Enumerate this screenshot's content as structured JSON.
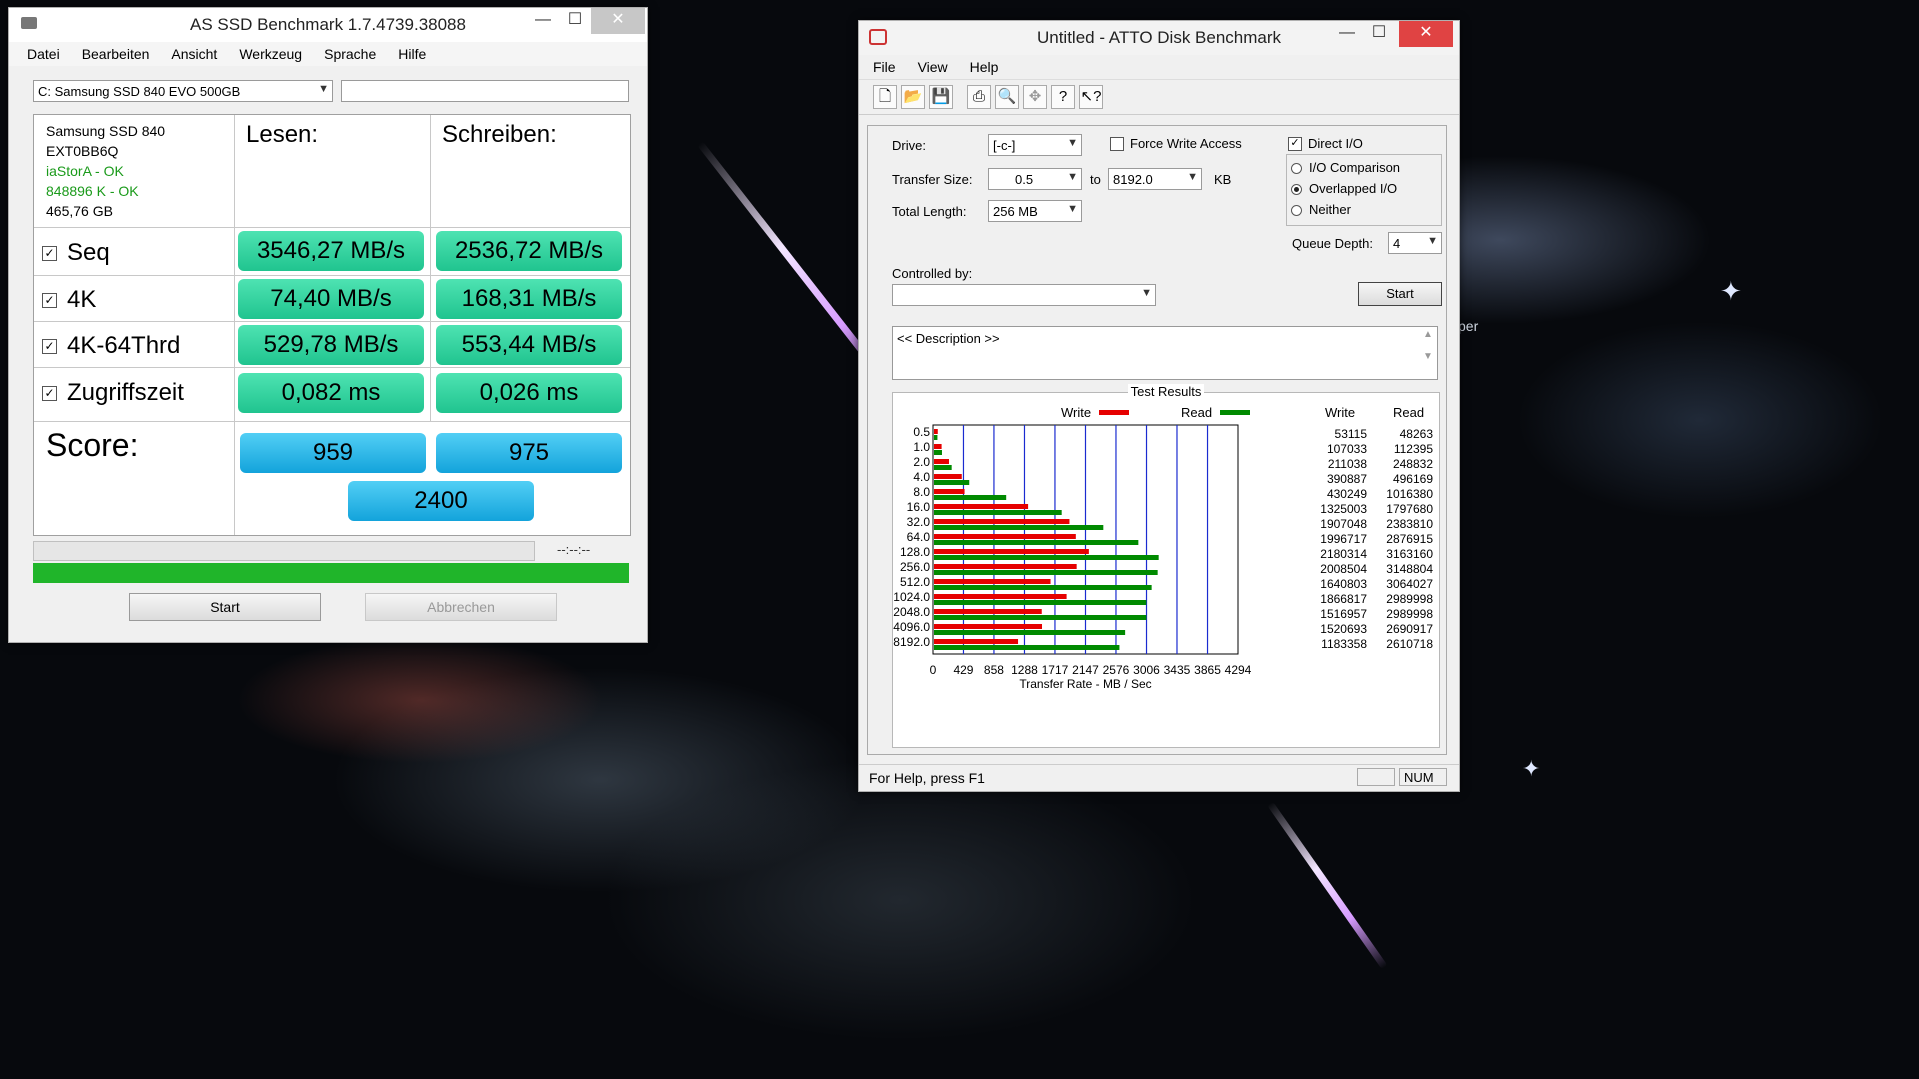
{
  "desktop": {
    "partial_text": "per"
  },
  "asssd": {
    "title": "AS SSD Benchmark 1.7.4739.38088",
    "menu": [
      "Datei",
      "Bearbeiten",
      "Ansicht",
      "Werkzeug",
      "Sprache",
      "Hilfe"
    ],
    "drive_select": "C: Samsung SSD 840 EVO 500GB",
    "device": {
      "name": "Samsung SSD 840",
      "firmware": "EXT0BB6Q",
      "driver_status": "iaStorA - OK",
      "alignment_status": "848896 K - OK",
      "capacity": "465,76 GB"
    },
    "headers": {
      "read": "Lesen:",
      "write": "Schreiben:"
    },
    "rows": [
      {
        "label": "Seq",
        "read": "3546,27 MB/s",
        "write": "2536,72 MB/s"
      },
      {
        "label": "4K",
        "read": "74,40 MB/s",
        "write": "168,31 MB/s"
      },
      {
        "label": "4K-64Thrd",
        "read": "529,78 MB/s",
        "write": "553,44 MB/s"
      },
      {
        "label": "Zugriffszeit",
        "read": "0,082 ms",
        "write": "0,026 ms"
      }
    ],
    "score": {
      "label": "Score:",
      "read": "959",
      "write": "975",
      "total": "2400"
    },
    "timer": "--:--:--",
    "progress": 1.0,
    "buttons": {
      "start": "Start",
      "abort": "Abbrechen"
    },
    "colors": {
      "result_green": "#20c48f",
      "score_blue": "#13a3db",
      "progress_green": "#20b52a"
    }
  },
  "atto": {
    "title": "Untitled - ATTO Disk Benchmark",
    "menu": [
      "File",
      "View",
      "Help"
    ],
    "toolbar_icons": [
      "new-icon",
      "open-icon",
      "save-icon",
      "print-icon",
      "print-preview-icon",
      "move-icon",
      "help-icon",
      "context-help-icon"
    ],
    "settings": {
      "drive_label": "Drive:",
      "drive": "[-c-]",
      "transfer_label": "Transfer Size:",
      "transfer_from": "0.5",
      "to_label": "to",
      "transfer_to": "8192.0",
      "kb_label": "KB",
      "length_label": "Total Length:",
      "length": "256 MB",
      "force_write_label": "Force Write Access",
      "force_write": false,
      "direct_io_label": "Direct I/O",
      "direct_io": true,
      "io_comparison_label": "I/O Comparison",
      "overlapped_label": "Overlapped I/O",
      "neither_label": "Neither",
      "selected_mode": "Overlapped I/O",
      "queue_label": "Queue Depth:",
      "queue_depth": "4",
      "controlled_label": "Controlled by:",
      "controlled": "",
      "start_label": "Start",
      "description": "<< Description >>"
    },
    "results": {
      "title": "Test Results",
      "legend_write": "Write",
      "legend_read": "Read",
      "col_write": "Write",
      "col_read": "Read",
      "xlabel": "Transfer Rate - MB / Sec"
    },
    "status": {
      "message": "For Help, press F1",
      "num": "NUM"
    }
  },
  "chart_data": {
    "type": "bar",
    "orientation": "horizontal",
    "categories": [
      "0.5",
      "1.0",
      "2.0",
      "4.0",
      "8.0",
      "16.0",
      "32.0",
      "64.0",
      "128.0",
      "256.0",
      "512.0",
      "1024.0",
      "2048.0",
      "4096.0",
      "8192.0"
    ],
    "series": [
      {
        "name": "Write",
        "color": "#e60000",
        "values": [
          53115,
          107033,
          211038,
          390887,
          430249,
          1325003,
          1907048,
          1996717,
          2180314,
          2008504,
          1640803,
          1866817,
          1516957,
          1520693,
          1183358
        ]
      },
      {
        "name": "Read",
        "color": "#008a00",
        "values": [
          48263,
          112395,
          248832,
          496169,
          1016380,
          1797680,
          2383810,
          2876915,
          3163160,
          3148804,
          3064027,
          2989998,
          2989998,
          2690917,
          2610718
        ]
      }
    ],
    "x_ticks": [
      "0",
      "429",
      "858",
      "1288",
      "1717",
      "2147",
      "2576",
      "3006",
      "3435",
      "3865",
      "4294"
    ],
    "xlim": [
      0,
      4294
    ],
    "xlabel": "Transfer Rate - MB / Sec",
    "grid": true,
    "legend": "top"
  }
}
